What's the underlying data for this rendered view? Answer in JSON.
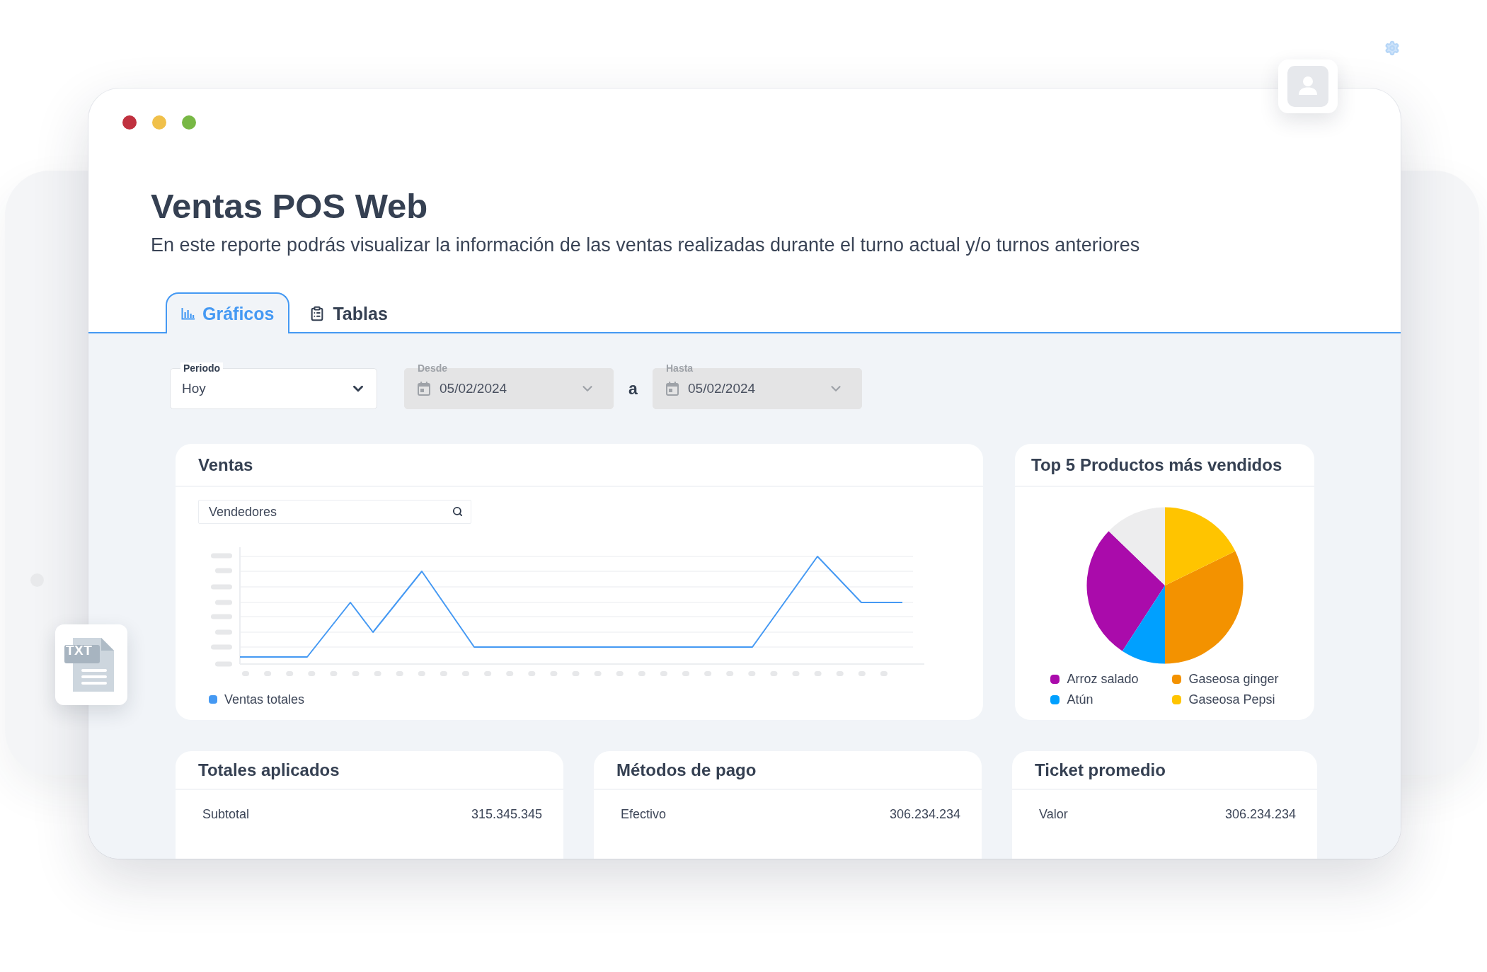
{
  "page": {
    "title": "Ventas POS Web",
    "description": "En este reporte podrás visualizar la información de las ventas realizadas durante el turno actual y/o turnos anteriores"
  },
  "tabs": [
    {
      "kind": "chart",
      "label": "Gráficos",
      "selected": true
    },
    {
      "kind": "table",
      "label": "Tablas",
      "selected": false
    }
  ],
  "filters": [
    {
      "kind": "select",
      "label": "Periodo",
      "value": "Hoy",
      "disabled": false
    },
    {
      "kind": "date",
      "label": "Desde",
      "value": "05/02/2024",
      "disabled": true
    },
    {
      "kind": "separator",
      "text": "a"
    },
    {
      "kind": "date",
      "label": "Hasta",
      "value": "05/02/2024",
      "disabled": true
    }
  ],
  "sales_card": {
    "title": "Ventas",
    "search": {
      "placeholder": "Vendedores"
    },
    "legend": [
      {
        "label": "Ventas totales"
      }
    ]
  },
  "top_products_card": {
    "title": "Top 5 Productos más vendidos",
    "legend": [
      {
        "label": "Arroz salado",
        "color": "#aa0bab"
      },
      {
        "label": "Gaseosa ginger",
        "color": "#f39200"
      },
      {
        "label": "Atún",
        "color": "#00a0ff"
      },
      {
        "label": "Gaseosa Pepsi",
        "color": "#ffc400"
      }
    ]
  },
  "summary_cards": [
    {
      "title": "Totales aplicados",
      "rows": [
        {
          "label": "Subtotal",
          "value": "315.345.345"
        }
      ]
    },
    {
      "title": "Métodos de pago",
      "rows": [
        {
          "label": "Efectivo",
          "value": "306.234.234"
        }
      ]
    },
    {
      "title": "Ticket promedio",
      "rows": [
        {
          "label": "Valor",
          "value": "306.234.234"
        }
      ]
    }
  ],
  "file_tile": {
    "badge": "TXT"
  }
}
